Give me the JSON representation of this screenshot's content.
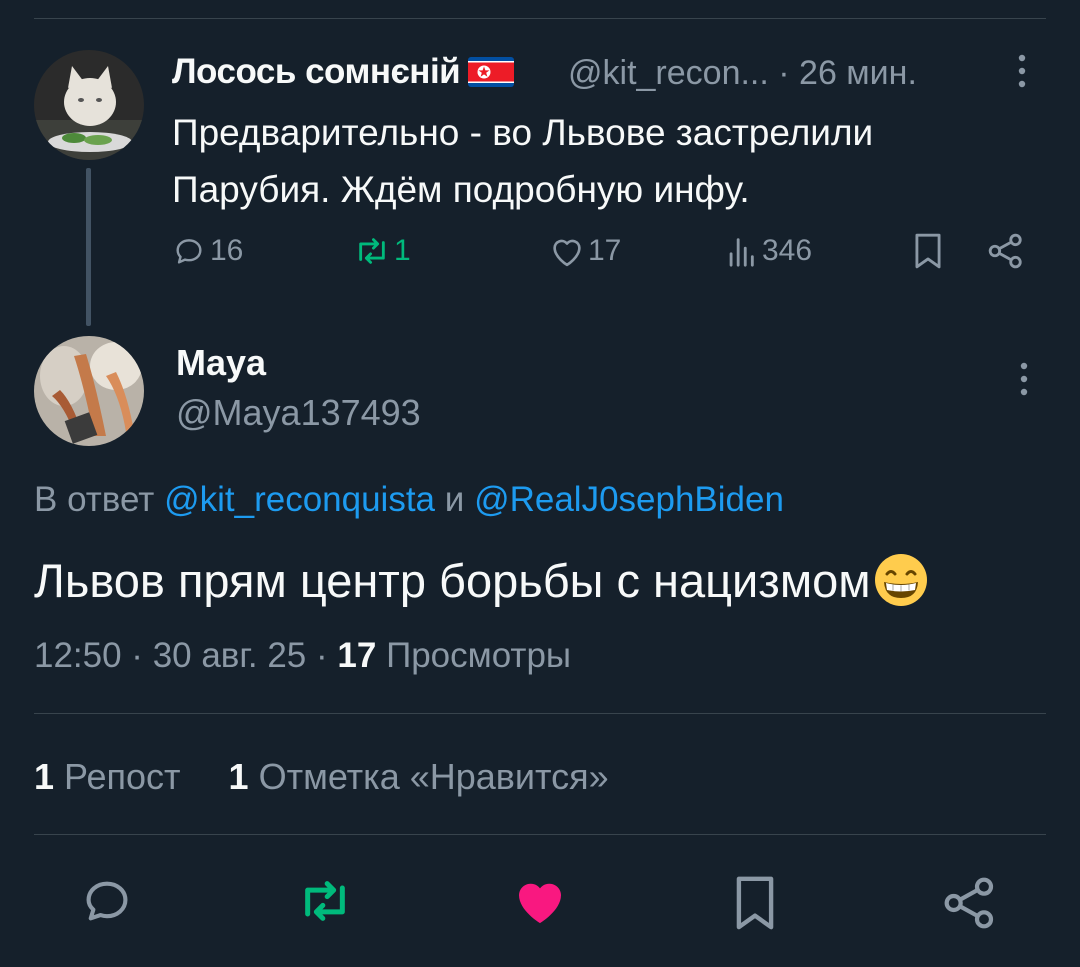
{
  "parent": {
    "display_name": "Лосось сомнєнiй",
    "flag": "north-korea-flag",
    "handle": "@kit_recon...",
    "time": "· 26 мин.",
    "text": "Предварительно - во Львове застрелили Парубия. Ждём подробную инфу.",
    "replies": "16",
    "reposts": "1",
    "likes": "17",
    "views": "346"
  },
  "reply": {
    "display_name": "Maya",
    "handle": "@Maya137493",
    "reply_prefix": "В ответ",
    "mention_1": "@kit_reconquista",
    "reply_and": "и",
    "mention_2": "@RealJ0sephBiden",
    "text": "Львов прям центр борьбы с нацизмом",
    "emoji": "grinning-face",
    "timestamp": "12:50 · 30 авг. 25 ·",
    "view_count": "17",
    "views_label": "Просмотры",
    "repost_count": "1",
    "repost_label": "Репост",
    "like_count": "1",
    "like_label": "Отметка «Нравится»"
  },
  "colors": {
    "background": "#15202b",
    "secondary_text": "#8b98a5",
    "link": "#1d9bf0",
    "repost_active": "#00ba7c",
    "like_active": "#f91880"
  }
}
